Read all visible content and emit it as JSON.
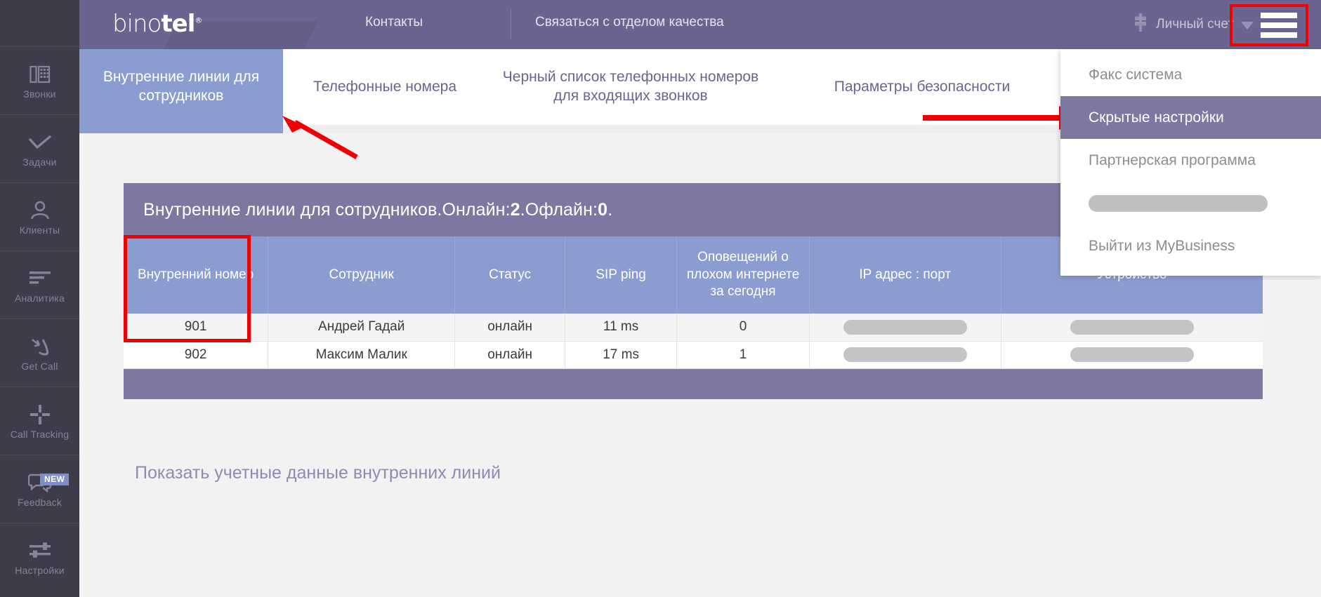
{
  "sidebar": {
    "items": [
      {
        "label": "Звонки",
        "icon": "phone-keypad-icon",
        "badge": null
      },
      {
        "label": "Задачи",
        "icon": "check-icon",
        "badge": null
      },
      {
        "label": "Клиенты",
        "icon": "person-icon",
        "badge": null
      },
      {
        "label": "Аналитика",
        "icon": "bars-icon",
        "badge": null
      },
      {
        "label": "Get Call",
        "icon": "incoming-call-icon",
        "badge": null
      },
      {
        "label": "Call Tracking",
        "icon": "crosshair-icon",
        "badge": null
      },
      {
        "label": "Feedback",
        "icon": "speech-bubble-icon",
        "badge": "NEW"
      },
      {
        "label": "Настройки",
        "icon": "sliders-icon",
        "badge": null
      }
    ]
  },
  "header": {
    "logo": "binotel",
    "links": [
      {
        "label": "Контакты"
      },
      {
        "label": "Связаться с отделом качества"
      }
    ],
    "account_label": "Личный счет",
    "account_icon": "dollar-icon",
    "burger_icon": "hamburger-menu-icon",
    "caret_icon": "caret-down-icon",
    "bg_color": "#6a6590"
  },
  "dropdown": {
    "items": [
      {
        "label": "Факс система",
        "state": "normal"
      },
      {
        "label": "Скрытые настройки",
        "state": "active"
      },
      {
        "label": "Партнерская программа",
        "state": "normal"
      },
      {
        "label": "",
        "state": "redacted"
      },
      {
        "label": "Выйти из MyBusiness",
        "state": "normal"
      }
    ],
    "active_bg": "#7c78a0"
  },
  "tabs": {
    "accent_color": "#8b9dd0",
    "items": [
      {
        "label": "Внутренние линии для сотрудников",
        "active": true
      },
      {
        "label": "Телефонные номера",
        "active": false
      },
      {
        "label": "Черный список телефонных номеров для входящих звонков",
        "active": false
      },
      {
        "label": "Параметры безопасности",
        "active": false
      }
    ]
  },
  "panel": {
    "title_prefix": "Внутренние линии для сотрудников. ",
    "online_label": "Онлайн: ",
    "online_value": "2",
    "online_dot": ". ",
    "offline_label": "Офлайн: ",
    "offline_value": "0",
    "offline_dot": ".",
    "title_bg": "#7c78a0"
  },
  "table": {
    "columns": [
      "Внутренний номер",
      "Сотрудник",
      "Статус",
      "SIP ping",
      "Оповещений о плохом интернете за сегодня",
      "IP адрес : порт",
      "Устройство"
    ],
    "rows": [
      {
        "extension": "901",
        "employee": "Андрей Гадай",
        "status": "онлайн",
        "sip_ping": "11 ms",
        "alerts": "0",
        "ip_port": "",
        "device": ""
      },
      {
        "extension": "902",
        "employee": "Максим Малик",
        "status": "онлайн",
        "sip_ping": "17 ms",
        "alerts": "1",
        "ip_port": "",
        "device": ""
      }
    ]
  },
  "footer": {
    "show_credentials_link": "Показать учетные данные внутренних линий"
  },
  "annotations": {
    "highlight_color": "#f00001",
    "arrow_to_active_tab": "arrow-icon",
    "arrow_to_hidden_settings": "arrow-icon",
    "box_around_burger": "highlight-box",
    "box_around_extension_column": "highlight-box"
  }
}
